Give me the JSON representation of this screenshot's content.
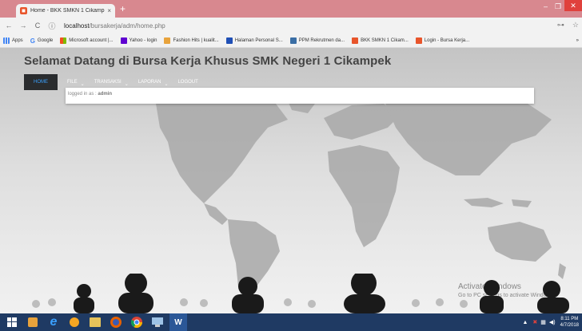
{
  "browser": {
    "tab_title": "Home - BKK SMKN 1 Cikampek",
    "tab_close": "×",
    "new_tab": "+",
    "window_min": "–",
    "window_max": "❐",
    "window_close": "✕",
    "back": "←",
    "forward": "→",
    "reload": "C",
    "info": "ⓘ",
    "url_host": "localhost",
    "url_path": "/bursakerja/adm/home.php",
    "key_icon": "⊶",
    "star_icon": "☆",
    "bookmarks": [
      {
        "label": "Apps",
        "color": "#4285f4"
      },
      {
        "label": "Google",
        "color": "#ffffff"
      },
      {
        "label": "Microsoft account |...",
        "color": "#f25022"
      },
      {
        "label": "Yahoo - login",
        "color": "#5f01d1"
      },
      {
        "label": "Fashion Hits | kualit...",
        "color": "#e8a33c"
      },
      {
        "label": "Halaman Personal S...",
        "color": "#1f4fb5"
      },
      {
        "label": "PPM Rekrutmen da...",
        "color": "#3a6ea5"
      },
      {
        "label": "BKK SMKN 1 Cikam...",
        "color": "#e8552b"
      },
      {
        "label": "Login - Bursa Kerja...",
        "color": "#e8552b"
      }
    ],
    "bookmarks_more": "»"
  },
  "page": {
    "title": "Selamat Datang di Bursa Kerja Khusus SMK Negeri 1 Cikampek",
    "menu": {
      "home": "HOME",
      "file": "FILE",
      "transaksi": "TRANSAKSI",
      "laporan": "LAPORAN",
      "logout": "LOGOUT",
      "caret": "⌄"
    },
    "login_prefix": "logged in as : ",
    "login_user": "admin"
  },
  "watermark": {
    "line1": "Activate Windows",
    "line2": "Go to PC settings to activate Windows."
  },
  "taskbar": {
    "time": "8:11 PM",
    "date": "4/7/2018"
  },
  "colors": {
    "titlebar": "#d8888f",
    "menu_bg": "#2a2c2e",
    "menu_home_text": "#3aa0ff",
    "taskbar": "#1f3a63"
  }
}
